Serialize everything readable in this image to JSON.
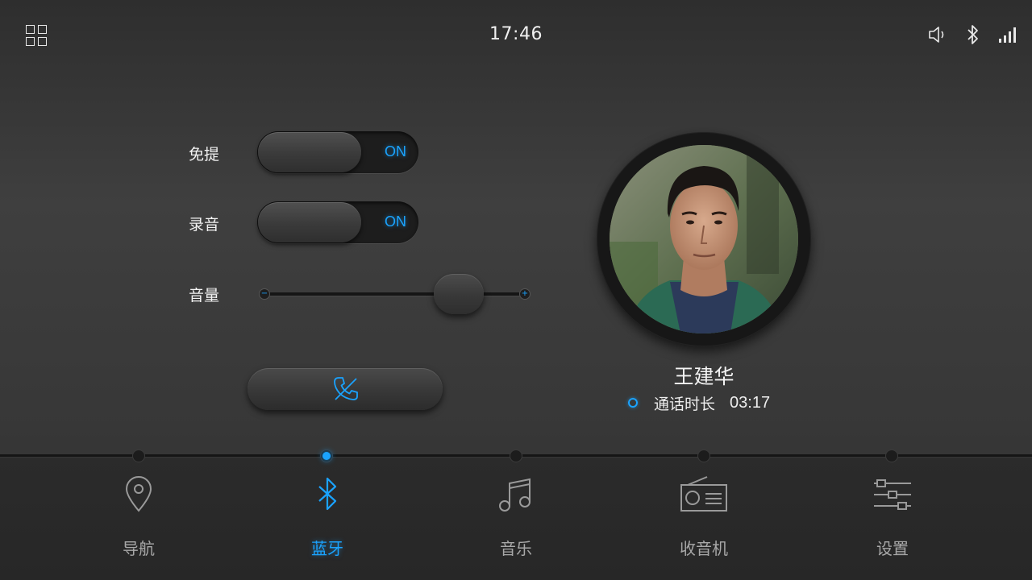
{
  "status_bar": {
    "time": "17:46",
    "icons": [
      "apps-grid-icon",
      "speaker-icon",
      "bluetooth-icon",
      "signal-icon"
    ]
  },
  "controls": {
    "handsfree": {
      "label": "免提",
      "state": "ON"
    },
    "recording": {
      "label": "录音",
      "state": "ON"
    },
    "volume": {
      "label": "音量",
      "level_fraction": 0.72
    },
    "hangup_icon": "hang-up-phone-icon"
  },
  "call": {
    "caller_name": "王建华",
    "duration_label": "通话时长",
    "duration": "03:17"
  },
  "nav": {
    "active_index": 1,
    "items": [
      {
        "label": "导航",
        "icon": "location-pin-icon"
      },
      {
        "label": "蓝牙",
        "icon": "bluetooth-icon"
      },
      {
        "label": "音乐",
        "icon": "music-note-icon"
      },
      {
        "label": "收音机",
        "icon": "radio-icon"
      },
      {
        "label": "设置",
        "icon": "sliders-icon"
      }
    ]
  },
  "colors": {
    "accent": "#1aa3ff",
    "background": "#3a3a3a",
    "nav_inactive": "#a8a8a8"
  }
}
